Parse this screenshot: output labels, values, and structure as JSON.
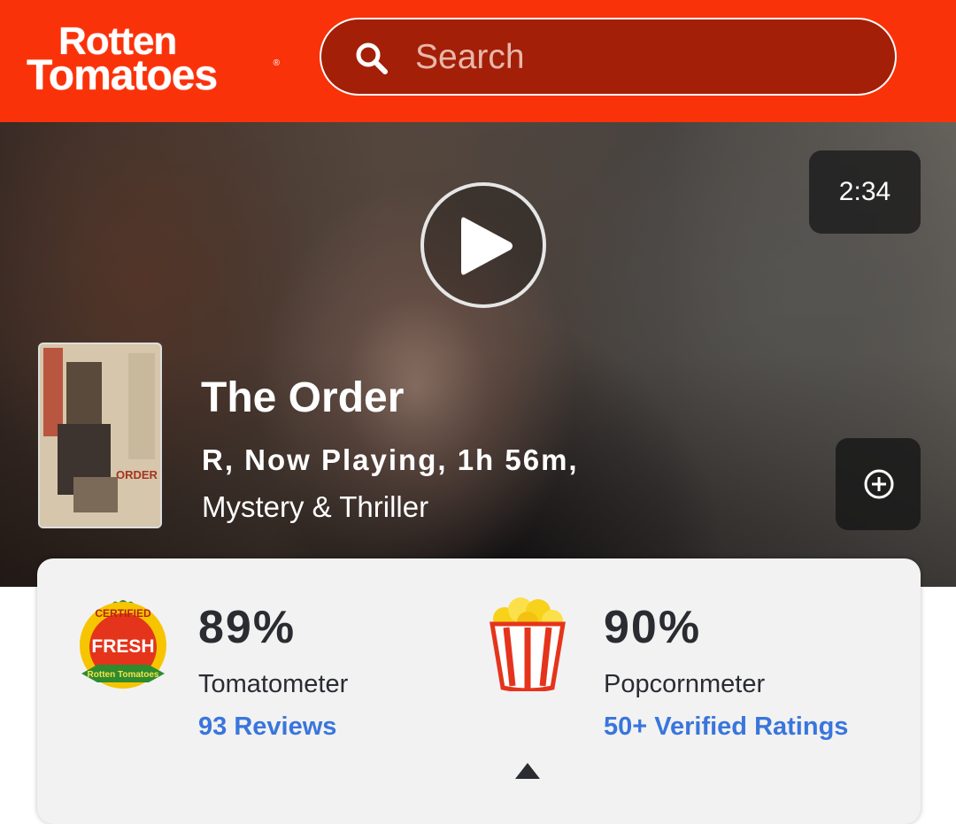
{
  "header": {
    "logo_line1": "Rotten",
    "logo_line2": "Tomatoes",
    "logo_reg": "®",
    "search_placeholder": "Search"
  },
  "hero": {
    "duration": "2:34",
    "title": "The Order",
    "meta": "R, Now Playing, 1h 56m,",
    "genre": "Mystery & Thriller",
    "poster_text": "ORDER"
  },
  "scores": {
    "tomatometer": {
      "badge_top": "CERTIFIED",
      "badge_main": "FRESH",
      "badge_brand": "Rotten Tomatoes",
      "percent": "89%",
      "label": "Tomatometer",
      "link": "93 Reviews"
    },
    "popcornmeter": {
      "percent": "90%",
      "label": "Popcornmeter",
      "link": "50+ Verified Ratings"
    }
  },
  "colors": {
    "brand": "#fa320a",
    "link": "#3976dc",
    "text": "#2a2c32"
  }
}
